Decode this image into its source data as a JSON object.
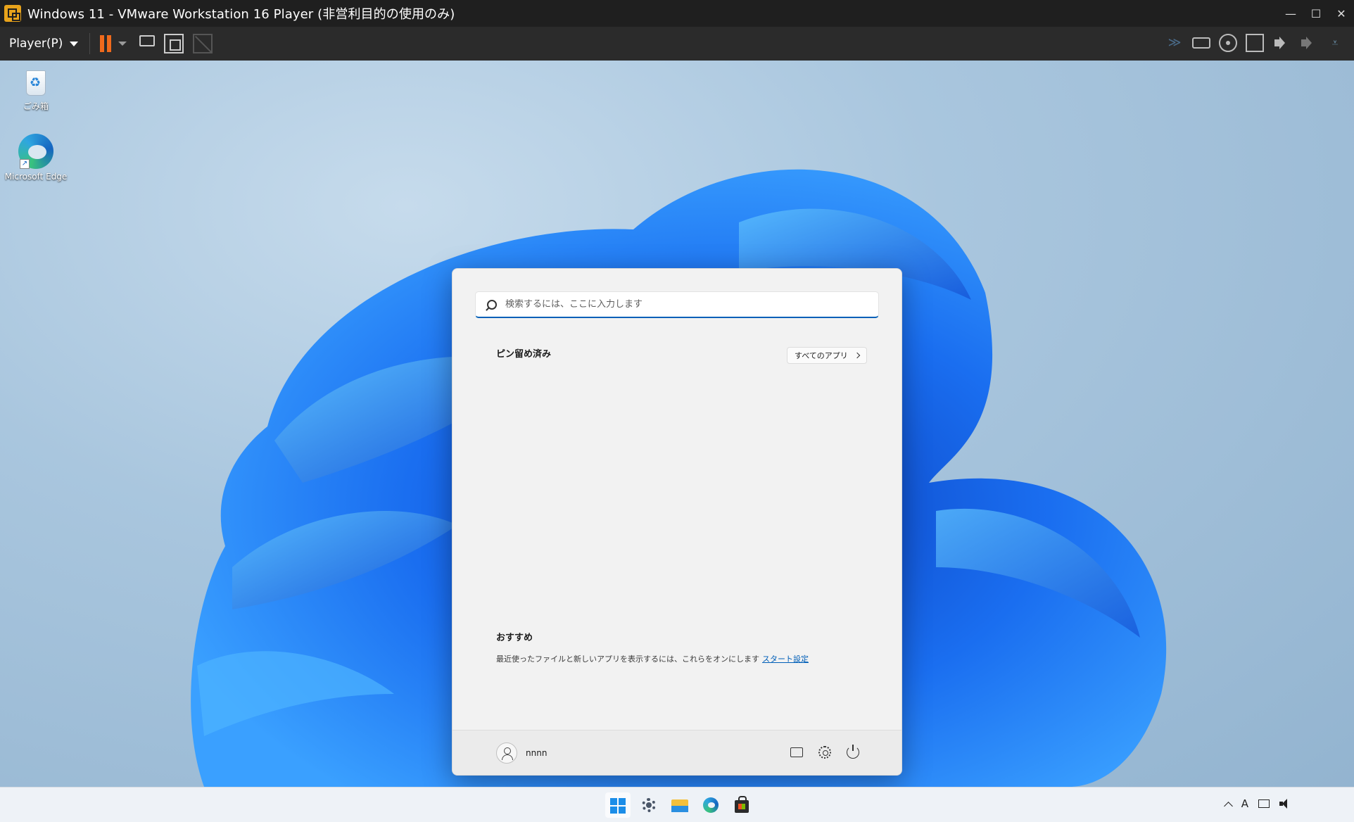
{
  "window": {
    "title": "Windows 11 - VMware Workstation 16 Player (非営利目的の使用のみ)",
    "minimize": "—",
    "maximize": "☐",
    "close": "✕"
  },
  "toolbar": {
    "player_menu": "Player(P)",
    "pause_color": "#f06a1c",
    "device_icons": [
      "multi-arrow-icon",
      "hard-disk-icon",
      "cd-dvd-icon",
      "network-adapter-icon",
      "sound-card-icon",
      "audio-icon",
      "usb-icon"
    ],
    "arrows_glyph": "≫",
    "usb_glyph": "⩡"
  },
  "desktop": {
    "icons": [
      {
        "label": "ごみ箱",
        "icon": "recycle-bin-icon"
      },
      {
        "label": "Microsoft Edge",
        "icon": "edge-icon"
      }
    ],
    "shortcut_glyph": "↗"
  },
  "start_menu": {
    "search_placeholder": "検索するには、ここに入力します",
    "pinned_title": "ピン留め済み",
    "all_apps_label": "すべてのアプリ",
    "recommended_title": "おすすめ",
    "recommended_text": "最近使ったファイルと新しいアプリを表示するには、これらをオンにします",
    "recommended_link": "スタート設定",
    "user_name": "nnnn",
    "accent_color": "#005fb8"
  },
  "taskbar": {
    "apps": [
      "start-icon",
      "settings-icon",
      "file-explorer-icon",
      "edge-icon",
      "store-icon"
    ],
    "tray_ime": "A"
  }
}
